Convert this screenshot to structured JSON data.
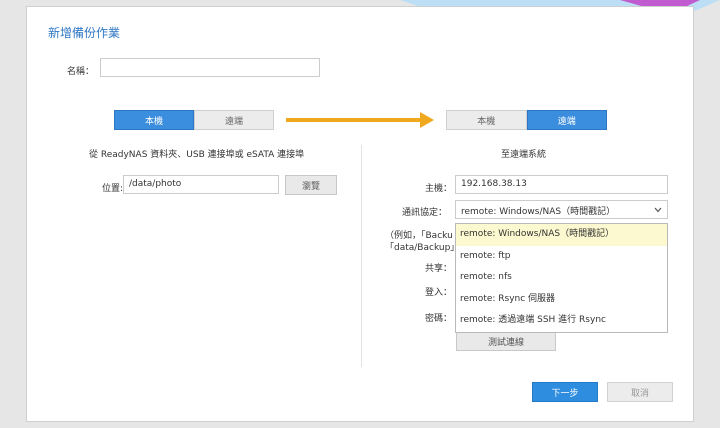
{
  "dialog": {
    "title": "新增備份作業",
    "name_label": "名稱：",
    "name_value": ""
  },
  "source": {
    "toggle_local": "本機",
    "toggle_remote": "遠端",
    "description": "從 ReadyNAS 資料夾、USB 連接埠或 eSATA 連接埠",
    "location_label": "位置:",
    "location_value": "/data/photo",
    "browse_button": "瀏覽"
  },
  "destination": {
    "toggle_local": "本機",
    "toggle_remote": "遠端",
    "heading": "至遠端系統",
    "host_label": "主機：",
    "host_value": "192.168.38.13",
    "protocol_label": "通訊協定：",
    "protocol_value": "remote: Windows/NAS（時間戳記）",
    "hint_line1": "（例如，「Backu",
    "hint_line2": "「data/Backup」'",
    "share_label": "共享：",
    "login_label": "登入：",
    "password_label": "密碼：",
    "test_button": "測試連線"
  },
  "protocol_options": [
    "remote: Windows/NAS（時間戳記）",
    "remote: ftp",
    "remote: nfs",
    "remote: Rsync 伺服器",
    "remote: 透過遠端 SSH 進行 Rsync"
  ],
  "footer": {
    "next_button": "下一步",
    "cancel_button": "取消"
  },
  "colors": {
    "accent": "#2f8de0",
    "title": "#2f77c4",
    "arrow": "#f0a81c",
    "selected_option": "#fcf8cf"
  },
  "icons": {
    "arrow": "right-arrow-icon",
    "dropdown": "chevron-down-icon"
  }
}
